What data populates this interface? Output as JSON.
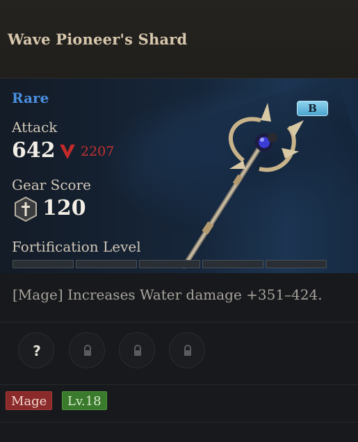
{
  "item": {
    "name": "Wave Pioneer's Shard",
    "rarity": "Rare",
    "rarity_color": "#4a8fe0",
    "grade_badge": "B"
  },
  "stats": {
    "attack_label": "Attack",
    "attack_value": "642",
    "attack_compare_value": "2207",
    "attack_compare_icon": "arrow-down-icon",
    "gear_score_label": "Gear Score",
    "gear_score_value": "120",
    "gear_score_icon": "sword-shield-icon",
    "fortification_label": "Fortification Level",
    "fortification_segments_filled": 0,
    "fortification_segments_total": 5
  },
  "description": "[Mage] Increases Water damage +351–424.",
  "sockets": [
    {
      "icon": "question-icon"
    },
    {
      "icon": "lock-icon"
    },
    {
      "icon": "lock-icon"
    },
    {
      "icon": "lock-icon"
    }
  ],
  "tags": {
    "class": "Mage",
    "level": "Lv.18"
  },
  "colors": {
    "compare_red": "#c83232",
    "class_tag": "#8b2a2a",
    "level_tag": "#3a7a2c"
  }
}
